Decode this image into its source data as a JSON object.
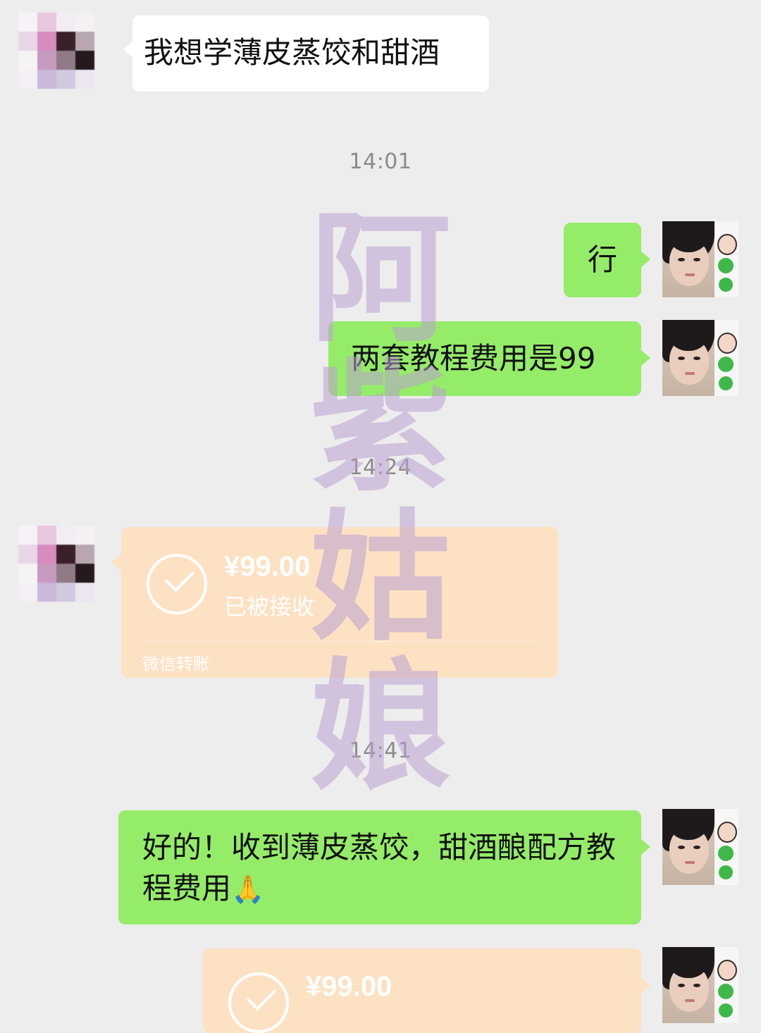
{
  "messages": {
    "m1": {
      "text": "我想学薄皮蒸饺和甜酒"
    },
    "m2": {
      "text": "行"
    },
    "m3": {
      "text": "两套教程费用是99"
    },
    "m4": {
      "text": "好的！收到薄皮蒸饺，甜酒酿配方教程费用",
      "emoji": "🙏"
    }
  },
  "timestamps": {
    "t1": "14:01",
    "t2": "14:24",
    "t3": "14:41"
  },
  "transfer1": {
    "amount": "¥99.00",
    "status": "已被接收",
    "footer": "微信转账"
  },
  "transfer2": {
    "amount": "¥99.00"
  },
  "watermark": {
    "chars": [
      "阿",
      "紫",
      "姑",
      "娘"
    ]
  },
  "colors": {
    "background": "#ededed",
    "bubble_incoming": "#ffffff",
    "bubble_outgoing": "#95ec69",
    "transfer_card": "#fde1c3",
    "timestamp_text": "#8b8b8b"
  },
  "icons": {
    "incoming_avatar": "pixelated-avatar",
    "outgoing_avatar": "user-photo-avatar",
    "transfer_status": "check-circle-icon"
  }
}
